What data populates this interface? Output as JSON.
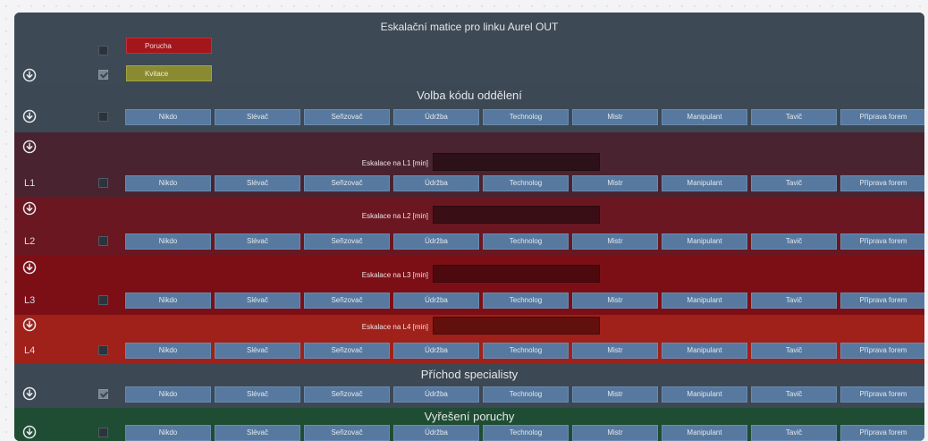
{
  "header": {
    "title": "Eskalační matice pro linku Aurel OUT",
    "legend": {
      "porucha_label": "Porucha",
      "kvitace_label": "Kvitace",
      "porucha_color": "#a3161b",
      "kvitace_color": "#8a8a32"
    },
    "checkbox_porucha_checked": false,
    "checkbox_kvitace_checked": true
  },
  "buttons": [
    "Nikdo",
    "Slévač",
    "Seřizovač",
    "Údržba",
    "Technolog",
    "Mistr",
    "Manipulant",
    "Tavič",
    "Příprava forem"
  ],
  "volba": {
    "title": "Volba kódu oddělení",
    "checked": false
  },
  "levels": [
    {
      "label": "L1",
      "escalation_label": "Eskalace na L1 [min]",
      "escalation_value": "",
      "color": "#4a2331",
      "input_color": "#2c1119"
    },
    {
      "label": "L2",
      "escalation_label": "Eskalace na L2 [min]",
      "escalation_value": "",
      "color": "#6a1722",
      "input_color": "#3a0e15"
    },
    {
      "label": "L3",
      "escalation_label": "Eskalace na L3 [min]",
      "escalation_value": "",
      "color": "#7c0f16",
      "input_color": "#4d0a0e"
    },
    {
      "label": "L4",
      "escalation_label": "Eskalace na L4 [min]",
      "escalation_value": "",
      "color": "#a0201a",
      "input_color": "#62100d"
    }
  ],
  "prichod": {
    "title": "Příchod specialisty",
    "checked": true
  },
  "vyreseni": {
    "title": "Vyřešení poruchy",
    "checked": false
  },
  "icons": {
    "row_icon": "circle-download-icon"
  }
}
